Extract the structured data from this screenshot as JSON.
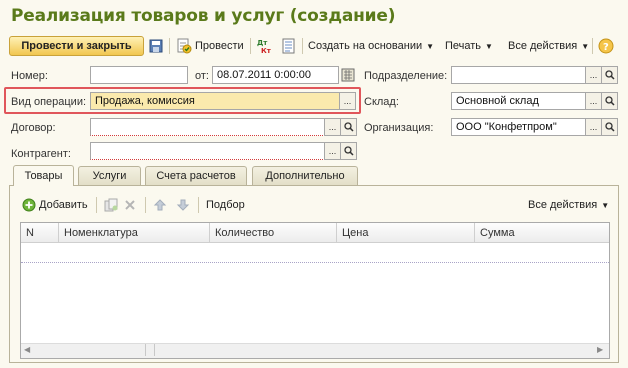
{
  "window": {
    "title": "Реализация товаров и услуг (создание)"
  },
  "toolbar": {
    "post_and_close": "Провести и закрыть",
    "post": "Провести",
    "create_based_on": "Создать на основании",
    "print": "Печать",
    "all_actions": "Все действия"
  },
  "form": {
    "number_label": "Номер:",
    "number_value": "",
    "date_label": "от:",
    "date_value": "08.07.2011  0:00:00",
    "division_label": "Подразделение:",
    "division_value": "",
    "operation_label": "Вид операции:",
    "operation_value": "Продажа, комиссия",
    "warehouse_label": "Склад:",
    "warehouse_value": "Основной склад",
    "contract_label": "Договор:",
    "contract_value": "",
    "organization_label": "Организация:",
    "organization_value": "ООО \"Конфетпром\"",
    "counterparty_label": "Контрагент:",
    "counterparty_value": ""
  },
  "tabs": [
    {
      "label": "Товары"
    },
    {
      "label": "Услуги"
    },
    {
      "label": "Счета расчетов"
    },
    {
      "label": "Дополнительно"
    }
  ],
  "table_toolbar": {
    "add": "Добавить",
    "selection": "Подбор",
    "all_actions": "Все действия"
  },
  "table": {
    "columns": [
      "N",
      "Номенклатура",
      "Количество",
      "Цена",
      "Сумма"
    ],
    "rows": []
  },
  "colors": {
    "title": "#5a7a1a",
    "highlight_border": "#e0565b",
    "required_underline": "#d43b3b"
  }
}
